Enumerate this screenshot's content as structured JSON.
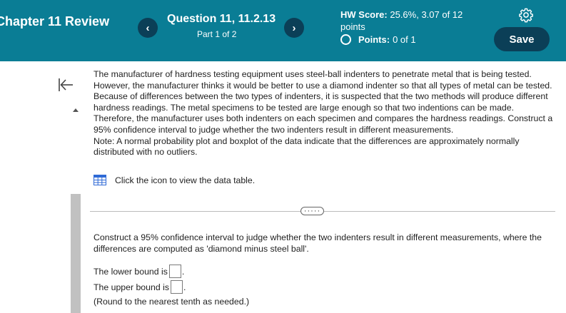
{
  "header": {
    "chapter_title": "Chapter 11 Review",
    "prev_icon": "chevron-left-icon",
    "prev_label": "‹",
    "next_icon": "chevron-right-icon",
    "next_label": "›",
    "question_title": "Question 11, 11.2.13",
    "question_part": "Part 1 of 2",
    "hw_score_label": "HW Score:",
    "hw_score_value": "25.6%, 3.07 of 12 points",
    "points_label": "Points:",
    "points_value": "0 of 1",
    "settings_icon": "gear-icon",
    "save_label": "Save"
  },
  "colors": {
    "header_bg": "#0a7d95",
    "button_dark": "#0b3f57",
    "table_icon": "#2f6ad6"
  },
  "problem": {
    "text": "The manufacturer of hardness testing equipment uses steel-ball indenters to penetrate metal that is being tested. However, the manufacturer thinks it would be better to use a diamond indenter so that all types of metal can be tested. Because of differences between the two types of indenters, it is suspected that the two methods will produce different hardness readings. The metal specimens to be tested are large enough so that two indentions can be made. Therefore, the manufacturer uses both indenters on each specimen and compares the hardness readings. Construct a 95% confidence interval to judge whether the two indenters result in different measurements.",
    "note": "Note: A normal probability plot and boxplot of the data indicate that the differences are approximately normally distributed with no outliers.",
    "data_table_icon": "table-icon",
    "data_table_link": "Click the icon to view the data table."
  },
  "more_button_label": "·····",
  "question": {
    "prompt": "Construct a 95% confidence interval to judge whether the two indenters result in different measurements, where the differences are computed as 'diamond minus steel ball'.",
    "lower_label": "The lower bound is",
    "lower_value": "",
    "upper_label": "The upper bound is",
    "upper_value": "",
    "period": ".",
    "round_note": "(Round to the nearest tenth as needed.)"
  },
  "sidebar": {
    "collapse_icon": "collapse-left-icon",
    "scroll_up_icon": "scroll-up-arrow-icon"
  }
}
